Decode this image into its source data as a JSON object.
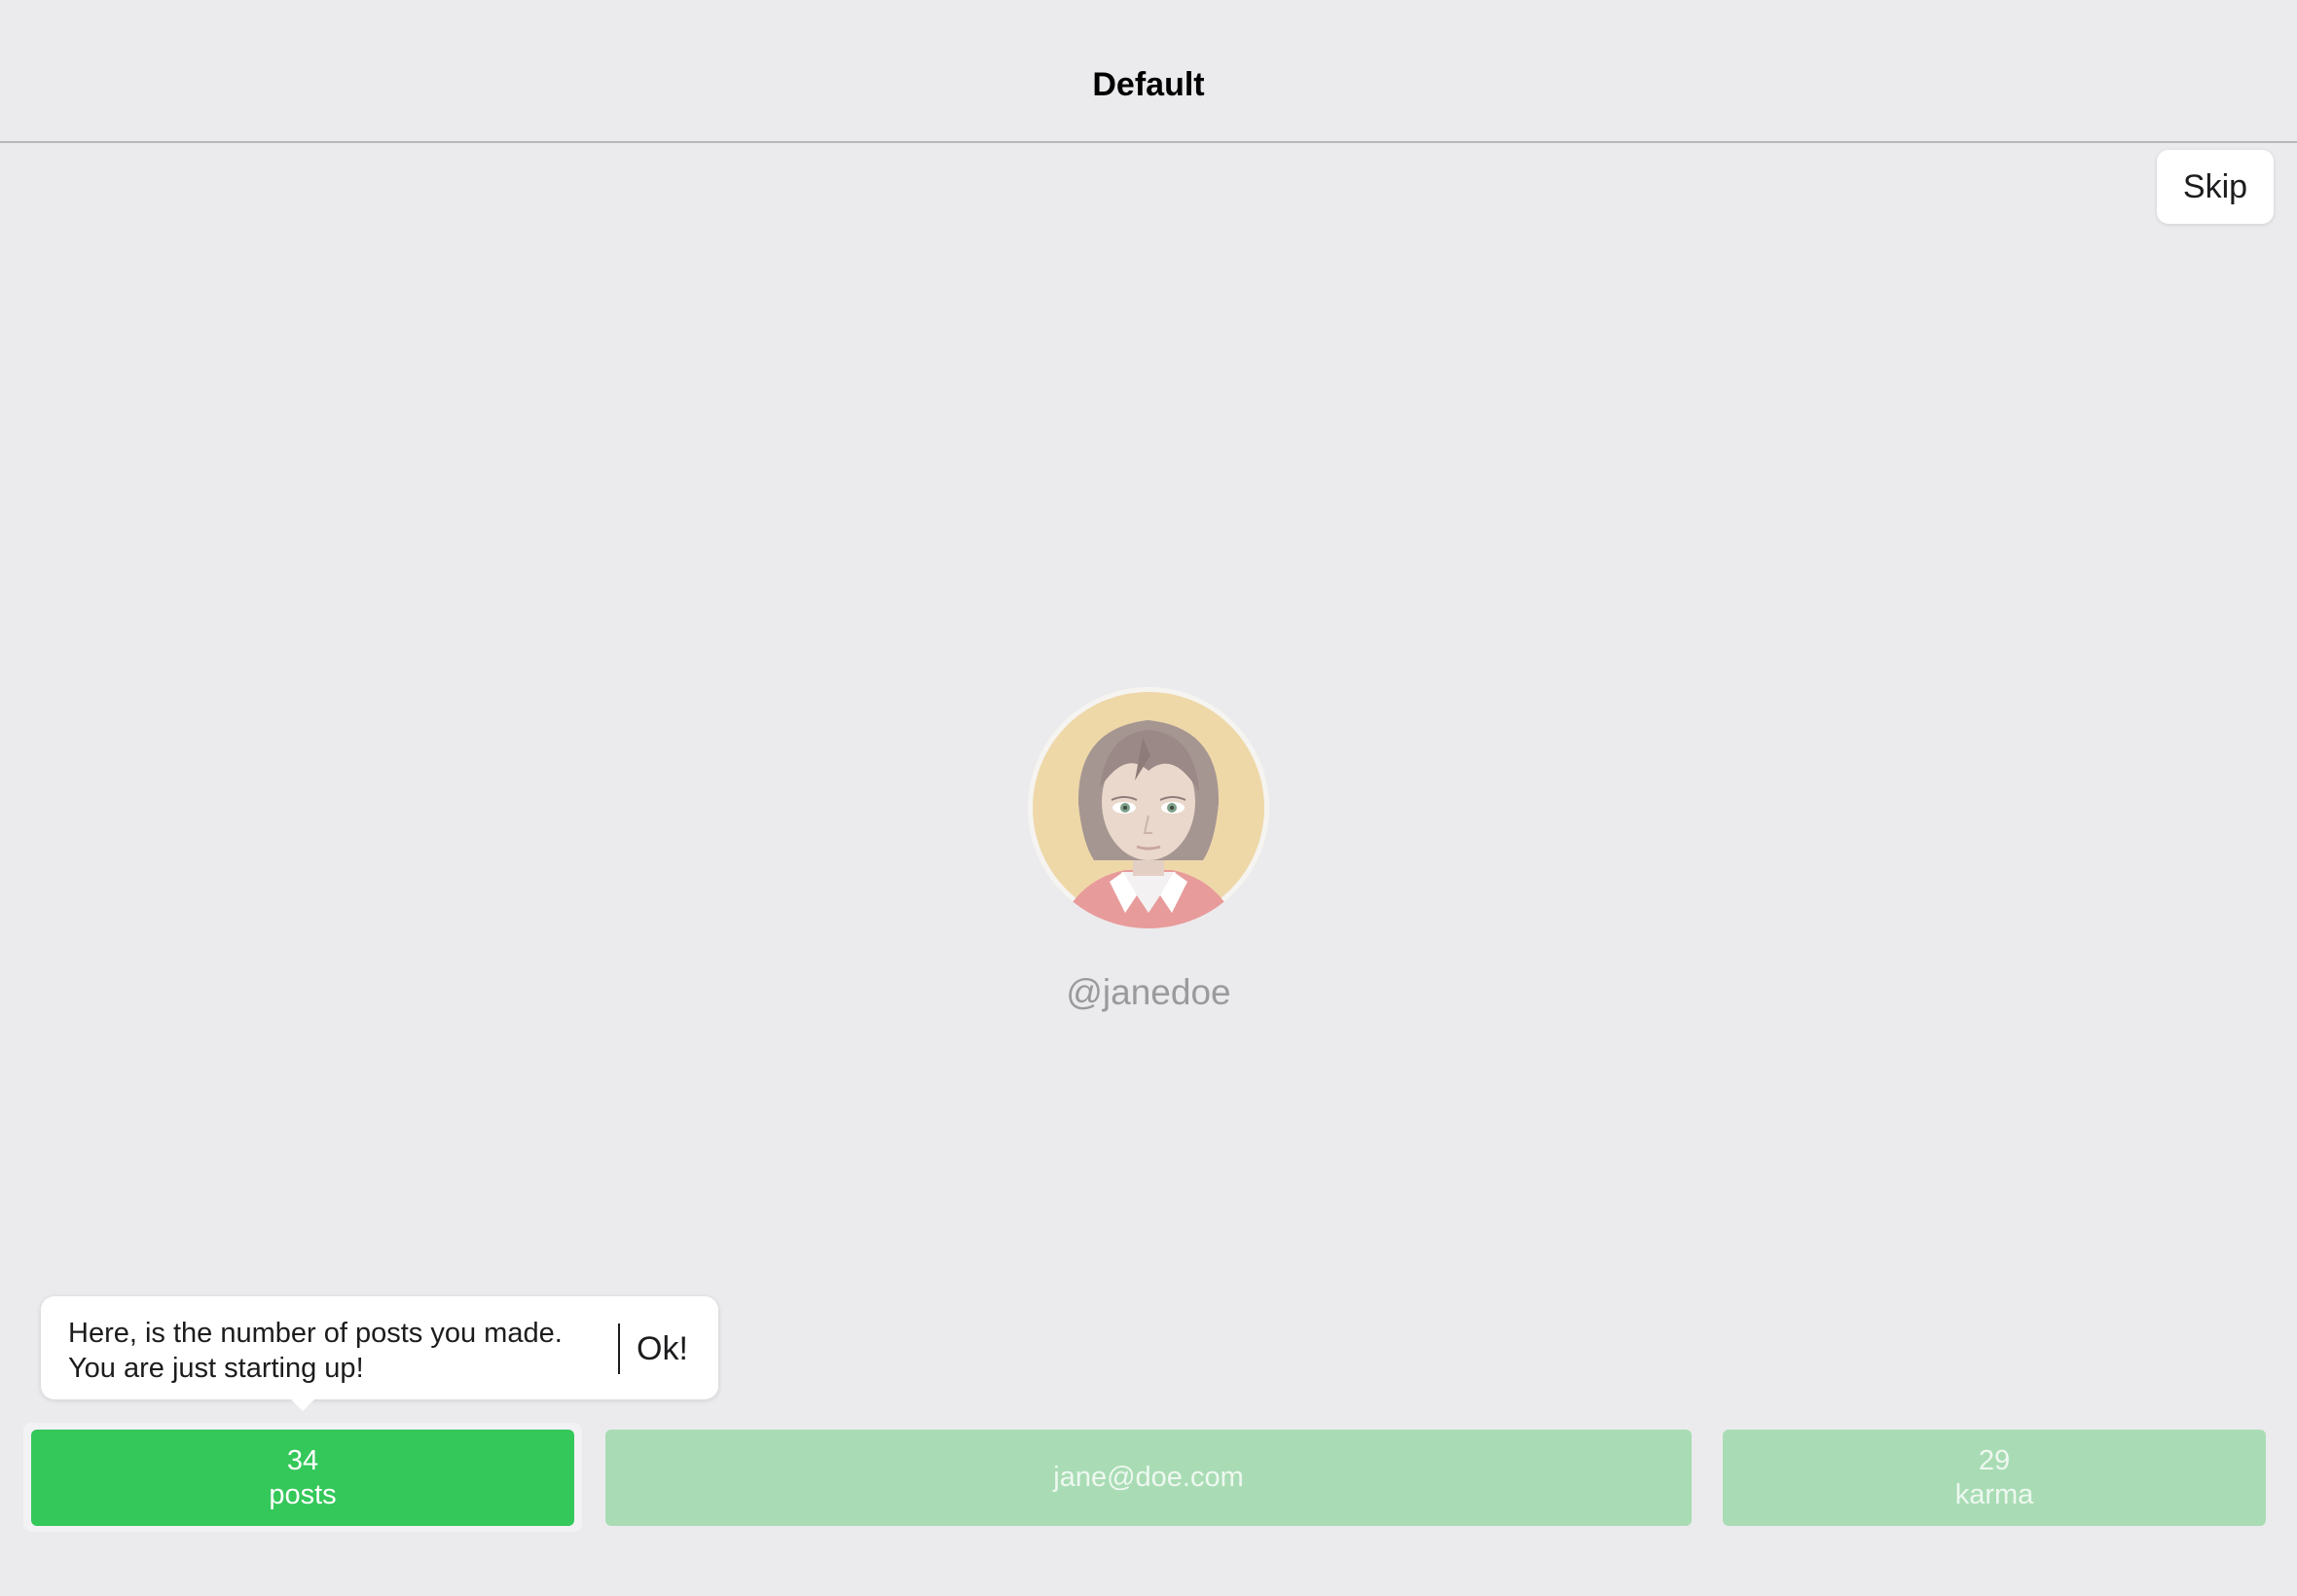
{
  "nav": {
    "title": "Default"
  },
  "skip_label": "Skip",
  "profile": {
    "username": "@janedoe",
    "avatar_icon": "woman-avatar-icon"
  },
  "tooltip": {
    "line1": "Here, is the number of posts you made.",
    "line2": "You are just starting up!",
    "ok_label": "Ok!"
  },
  "stats": {
    "posts_count": "34",
    "posts_label": "posts",
    "email": "jane@doe.com",
    "karma_count": "29",
    "karma_label": "karma"
  },
  "colors": {
    "accent_green": "#34c759",
    "dimmed_green": "#a9dcb5",
    "background": "#ebebed"
  }
}
